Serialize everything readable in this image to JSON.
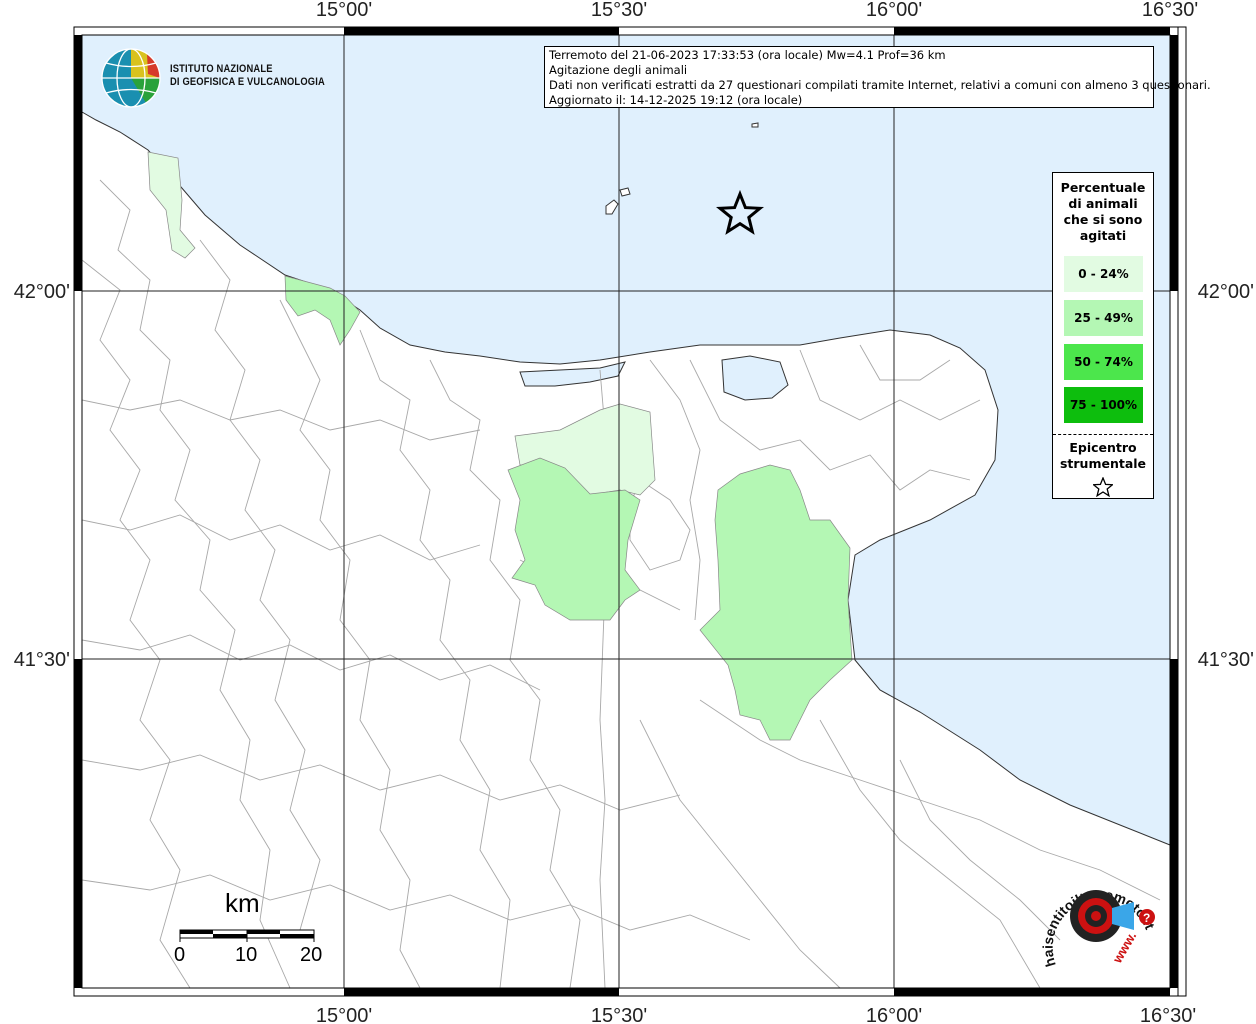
{
  "info": {
    "line1": "Terremoto del 21-06-2023 17:33:53 (ora locale) Mw=4.1 Prof=36 km",
    "line2": "Agitazione degli animali",
    "line3": "Dati non verificati estratti da 27 questionari compilati tramite Internet, relativi a comuni con almeno 3 questionari.",
    "line4": "Aggiornato il: 14-12-2025 19:12 (ora locale)"
  },
  "logo": {
    "line1": "ISTITUTO NAZIONALE",
    "line2": "DI GEOFISICA E VULCANOLOGIA"
  },
  "axes": {
    "lon_labels": [
      "15°00'",
      "15°30'",
      "16°00'",
      "16°30'"
    ],
    "lat_labels": [
      "42°00'",
      "41°30'"
    ]
  },
  "legend": {
    "title_lines": [
      "Percentuale",
      "di animali",
      "che si sono",
      "agitati"
    ],
    "items": [
      {
        "label": "0 - 24%",
        "color": "#e2fbe2"
      },
      {
        "label": "25 - 49%",
        "color": "#b4f7b4"
      },
      {
        "label": "50 - 74%",
        "color": "#4ce64c"
      },
      {
        "label": "75 - 100%",
        "color": "#0dbe0d"
      }
    ],
    "epicentro_lines": [
      "Epicentro",
      "strumentale"
    ]
  },
  "scale": {
    "unit": "km",
    "ticks": [
      "0",
      "10",
      "20"
    ]
  },
  "colors": {
    "sea": "#e0f0fd",
    "land": "#ffffff",
    "border": "#a8a8a8"
  },
  "branding": {
    "text": "haisentitoilterremoto.it",
    "url": "www."
  }
}
